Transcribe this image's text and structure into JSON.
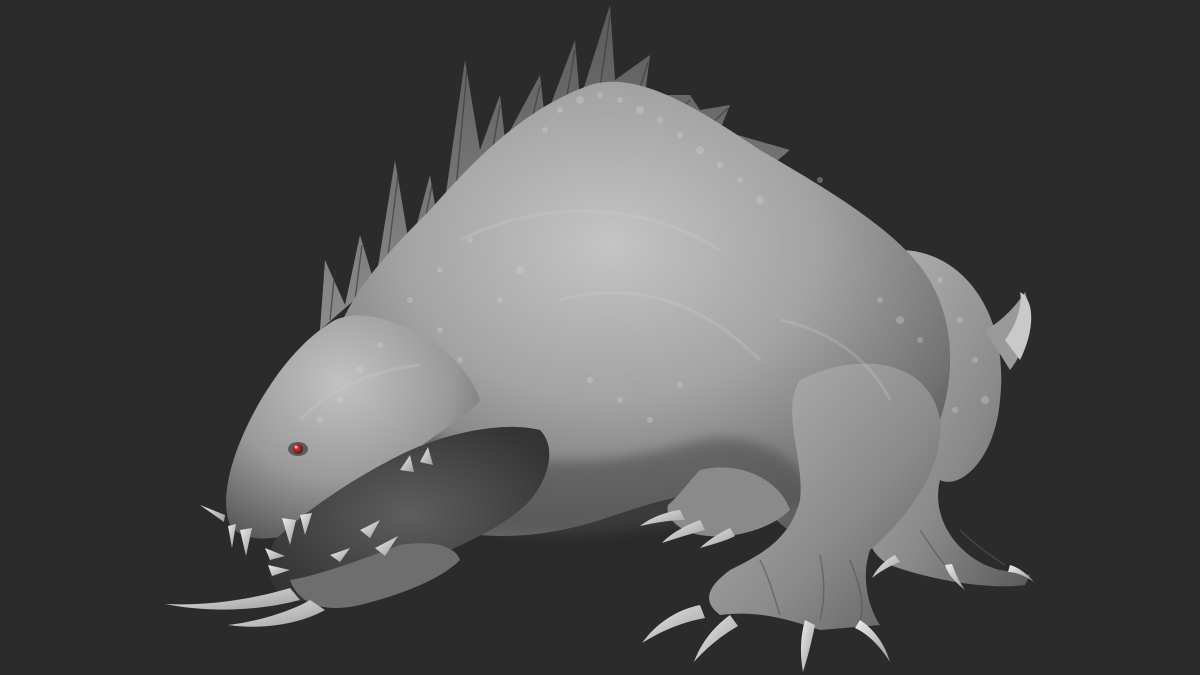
{
  "scene": {
    "subject": "creature-sculpt",
    "colors": {
      "background": "#2b2b2c",
      "clay_light": "#bdbdbd",
      "clay_mid": "#8e8e8e",
      "clay_dark": "#4a4a4a",
      "claw": "#d8d8d6",
      "eye": "#a3141b"
    }
  }
}
